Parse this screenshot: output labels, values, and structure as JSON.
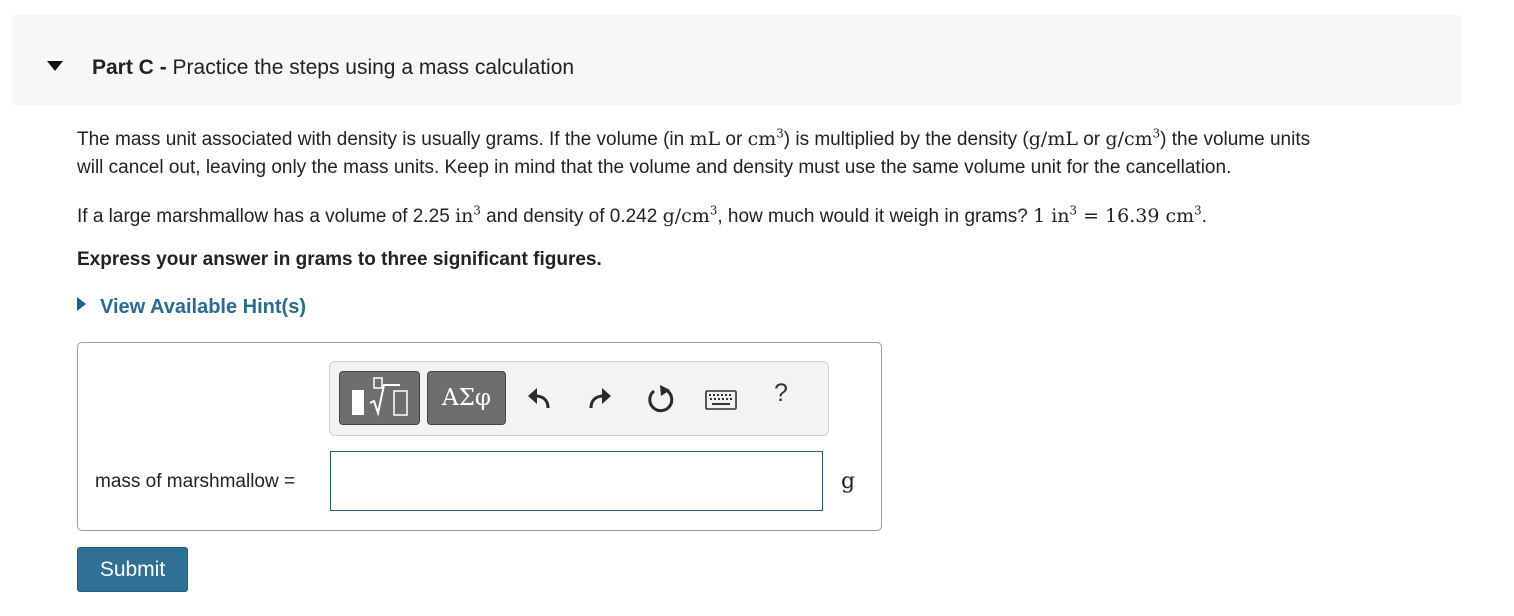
{
  "part": {
    "label": "Part C",
    "separator": " - ",
    "title": "Practice the steps using a mass calculation"
  },
  "intro": {
    "a": "The mass unit associated with density is usually grams. If the volume (in ",
    "m1": "mL",
    "b": " or ",
    "m2": "cm",
    "m2_exp": "3",
    "c": ") is multiplied by the density (",
    "m3": "g/mL",
    "d": " or ",
    "m4": "g/cm",
    "m4_exp": "3",
    "e": ") the volume units",
    "line2": "will cancel out, leaving only the mass units. Keep in mind that the volume and density must use the same volume unit for the cancellation."
  },
  "problem": {
    "a": "If a large marshmallow has a volume of 2.25 ",
    "m1": "in",
    "m1_exp": "3",
    "b": " and density of 0.242 ",
    "m2": "g/cm",
    "m2_exp": "3",
    "c": ", how much would it weigh in grams? ",
    "m3": "1 in",
    "m3_exp": "3",
    "m4": " = 16.39 cm",
    "m4_exp": "3",
    "d": "."
  },
  "instruction": "Express your answer in grams to three significant figures.",
  "hints_link": "View Available Hint(s)",
  "toolbar": {
    "greek_label": "ΑΣφ",
    "help_label": "?",
    "icons": [
      "templates-icon",
      "greek-symbols-icon",
      "undo-icon",
      "redo-icon",
      "reset-icon",
      "keyboard-icon",
      "help-icon"
    ]
  },
  "answer": {
    "label": "mass of marshmallow =",
    "value": "",
    "unit": "g"
  },
  "submit_label": "Submit",
  "colors": {
    "accent": "#2f7095",
    "link": "#2b6b91",
    "header_bg": "#f7f7f7",
    "toolbar_button": "#6e6e6e"
  }
}
